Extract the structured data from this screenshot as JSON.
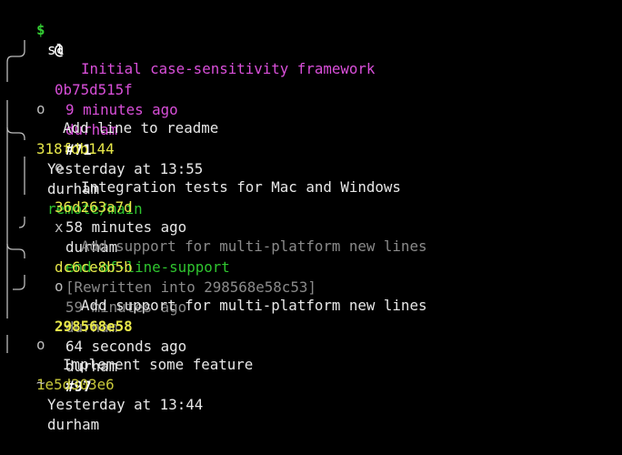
{
  "prompt": {
    "symbol": "$",
    "command": "sl",
    "symbol_color": "#33cc33"
  },
  "colors": {
    "current_hash": "#d94fd9",
    "hash": "#e8e84a",
    "branch": "#2fc52f",
    "text": "#e8e8e8",
    "pr": "#ffffff",
    "dim": "#8a8a8a"
  },
  "commits": [
    {
      "marker": "@",
      "hash": "0b75d515f",
      "time": "9 minutes ago",
      "author": "durham",
      "pr": "#71",
      "message": "Initial case-sensitivity framework"
    },
    {
      "marker": "o",
      "hash": "318fdb144",
      "time": "Yesterday at 13:55",
      "author": "durham",
      "branch": "remote/main",
      "message": "Add line to readme"
    },
    {
      "marker": "o",
      "hash": "36d263a7d",
      "time": "58 minutes ago",
      "author": "durham",
      "branch": "end-of-line-support",
      "message": "Integration tests for Mac and Windows"
    },
    {
      "marker": "x",
      "hash": "dc6ce8b5b",
      "rewritten": "[Rewritten into 298568e58c53]",
      "time": "59 minutes ago",
      "author": "durham",
      "message": "Add support for multi-platform new lines"
    },
    {
      "marker": "o",
      "hash": "298568e58",
      "time": "64 seconds ago",
      "author": "durham",
      "pr": "#97",
      "message": "Add support for multi-platform new lines"
    },
    {
      "marker": "o",
      "hash": "1e5d303e6",
      "time": "Yesterday at 13:44",
      "author": "durham",
      "message": "Implement some feature"
    }
  ],
  "footer": {
    "tilde": "~"
  }
}
